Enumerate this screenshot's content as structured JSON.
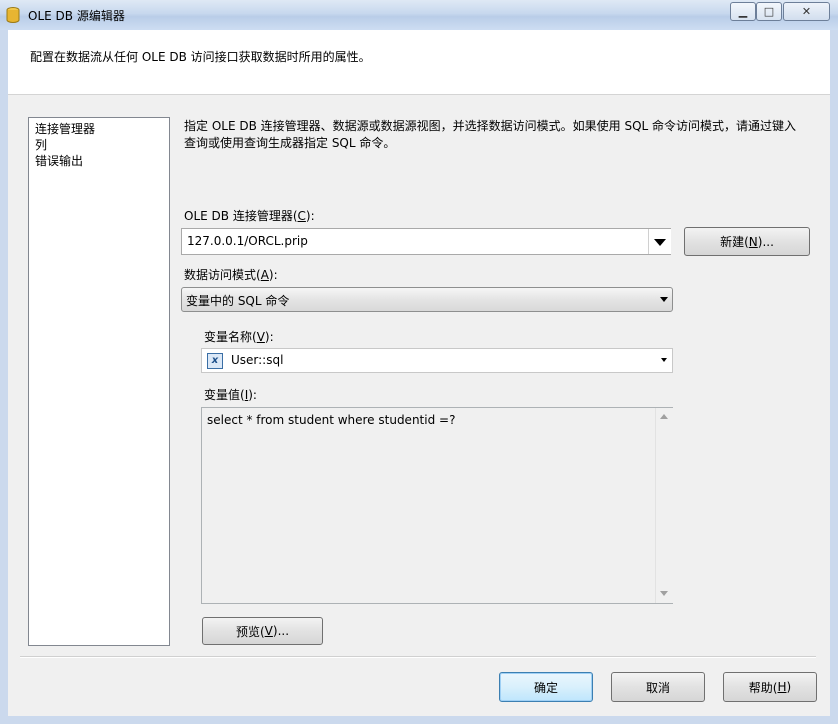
{
  "window": {
    "title": "OLE DB 源编辑器"
  },
  "header": {
    "description": "配置在数据流从任何 OLE DB 访问接口获取数据时所用的属性。"
  },
  "nav": {
    "items": [
      {
        "label": "连接管理器"
      },
      {
        "label": "列"
      },
      {
        "label": "错误输出"
      }
    ]
  },
  "main": {
    "instructions": "指定 OLE DB 连接管理器、数据源或数据源视图，并选择数据访问模式。如果使用 SQL 命令访问模式，请通过键入查询或使用查询生成器指定 SQL 命令。",
    "connection": {
      "label_prefix": "OLE DB 连接管理器(",
      "label_key": "C",
      "label_suffix": "):",
      "value": "127.0.0.1/ORCL.prip"
    },
    "new_button": {
      "prefix": "新建(",
      "key": "N",
      "suffix": ")..."
    },
    "access_mode": {
      "label_prefix": "数据访问模式(",
      "label_key": "A",
      "label_suffix": "):",
      "value": "变量中的 SQL 命令"
    },
    "variable_name": {
      "label_prefix": "变量名称(",
      "label_key": "V",
      "label_suffix": "):",
      "value": "User::sql",
      "icon": "variable-icon"
    },
    "variable_value": {
      "label_prefix": "变量值(",
      "label_key": "I",
      "label_suffix": "):",
      "value": "select * from student where studentid =?"
    },
    "preview_button": {
      "prefix": "预览(",
      "key": "V",
      "suffix": ")..."
    }
  },
  "footer": {
    "ok": "确定",
    "cancel": "取消",
    "help": {
      "prefix": "帮助(",
      "key": "H",
      "suffix": ")"
    }
  }
}
